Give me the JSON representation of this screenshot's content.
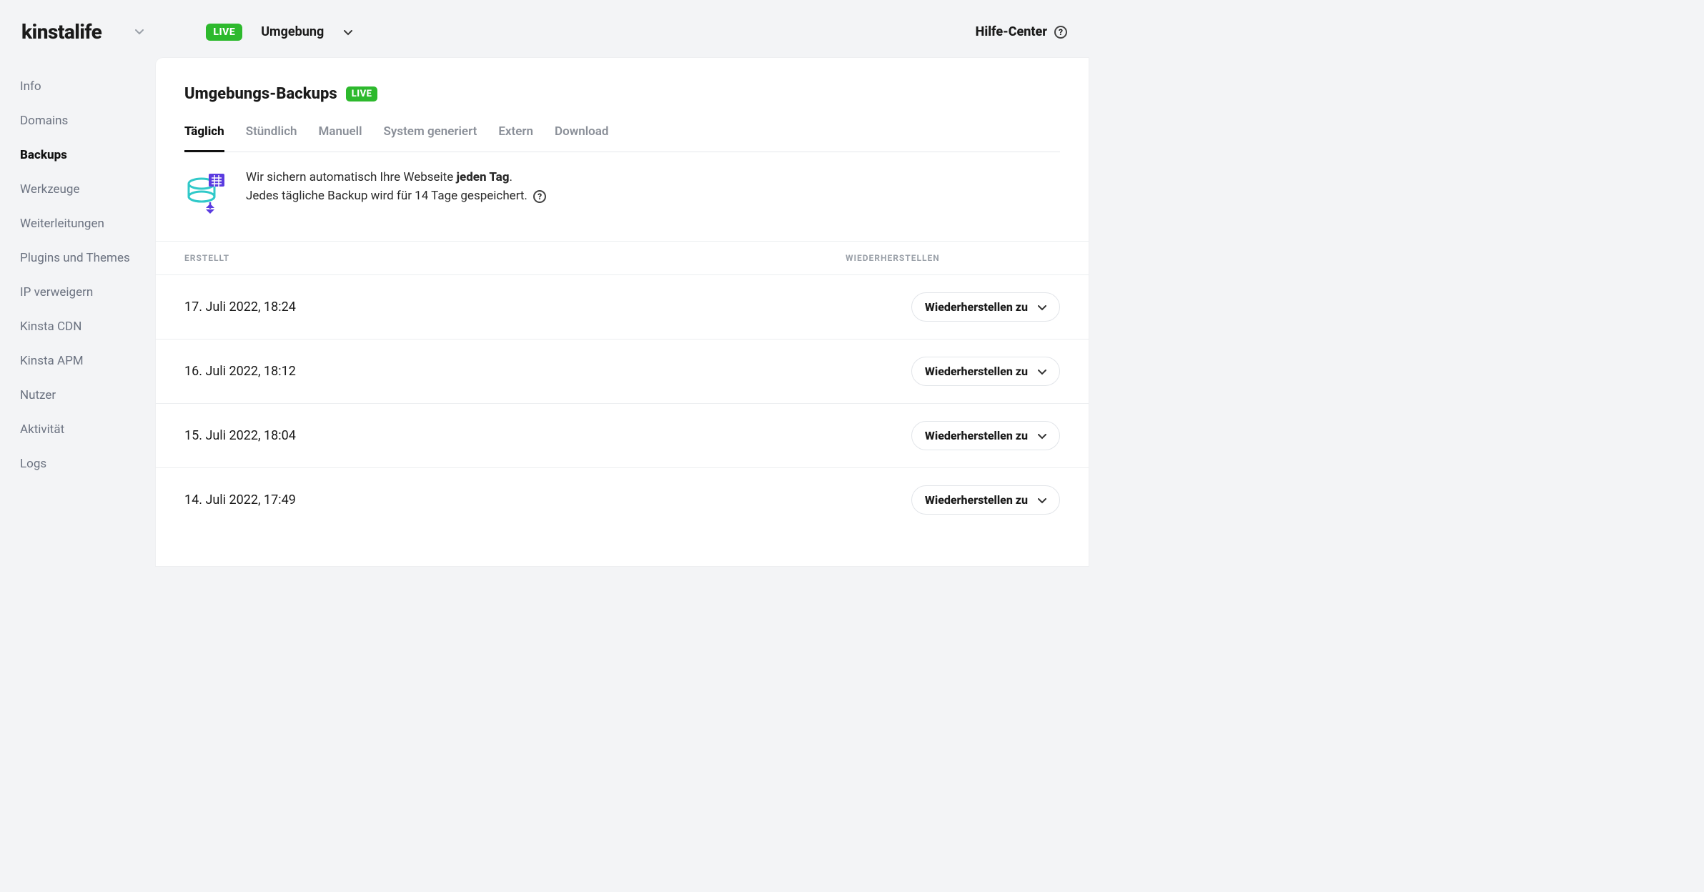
{
  "brand": "kinstalife",
  "env_pill": "LIVE",
  "env_label": "Umgebung",
  "help_center": "Hilfe-Center",
  "sidebar": {
    "items": [
      {
        "label": "Info"
      },
      {
        "label": "Domains"
      },
      {
        "label": "Backups"
      },
      {
        "label": "Werkzeuge"
      },
      {
        "label": "Weiterleitungen"
      },
      {
        "label": "Plugins und Themes"
      },
      {
        "label": "IP verweigern"
      },
      {
        "label": "Kinsta CDN"
      },
      {
        "label": "Kinsta APM"
      },
      {
        "label": "Nutzer"
      },
      {
        "label": "Aktivität"
      },
      {
        "label": "Logs"
      }
    ],
    "active_index": 2
  },
  "page": {
    "title": "Umgebungs-Backups",
    "live_badge": "LIVE"
  },
  "tabs": {
    "items": [
      {
        "label": "Täglich"
      },
      {
        "label": "Stündlich"
      },
      {
        "label": "Manuell"
      },
      {
        "label": "System generiert"
      },
      {
        "label": "Extern"
      },
      {
        "label": "Download"
      }
    ],
    "active_index": 0
  },
  "info": {
    "line1_prefix": "Wir sichern automatisch Ihre Webseite ",
    "line1_bold": "jeden Tag",
    "line1_suffix": ".",
    "line2": "Jedes tägliche Backup wird für 14 Tage gespeichert."
  },
  "table": {
    "header_created": "ERSTELLT",
    "header_restore": "WIEDERHERSTELLEN",
    "restore_label": "Wiederherstellen zu",
    "rows": [
      {
        "created": "17. Juli 2022, 18:24"
      },
      {
        "created": "16. Juli 2022, 18:12"
      },
      {
        "created": "15. Juli 2022, 18:04"
      },
      {
        "created": "14. Juli 2022, 17:49"
      }
    ]
  },
  "colors": {
    "green": "#2db92d",
    "teal": "#30c9c9",
    "purple": "#5b3ce0"
  }
}
